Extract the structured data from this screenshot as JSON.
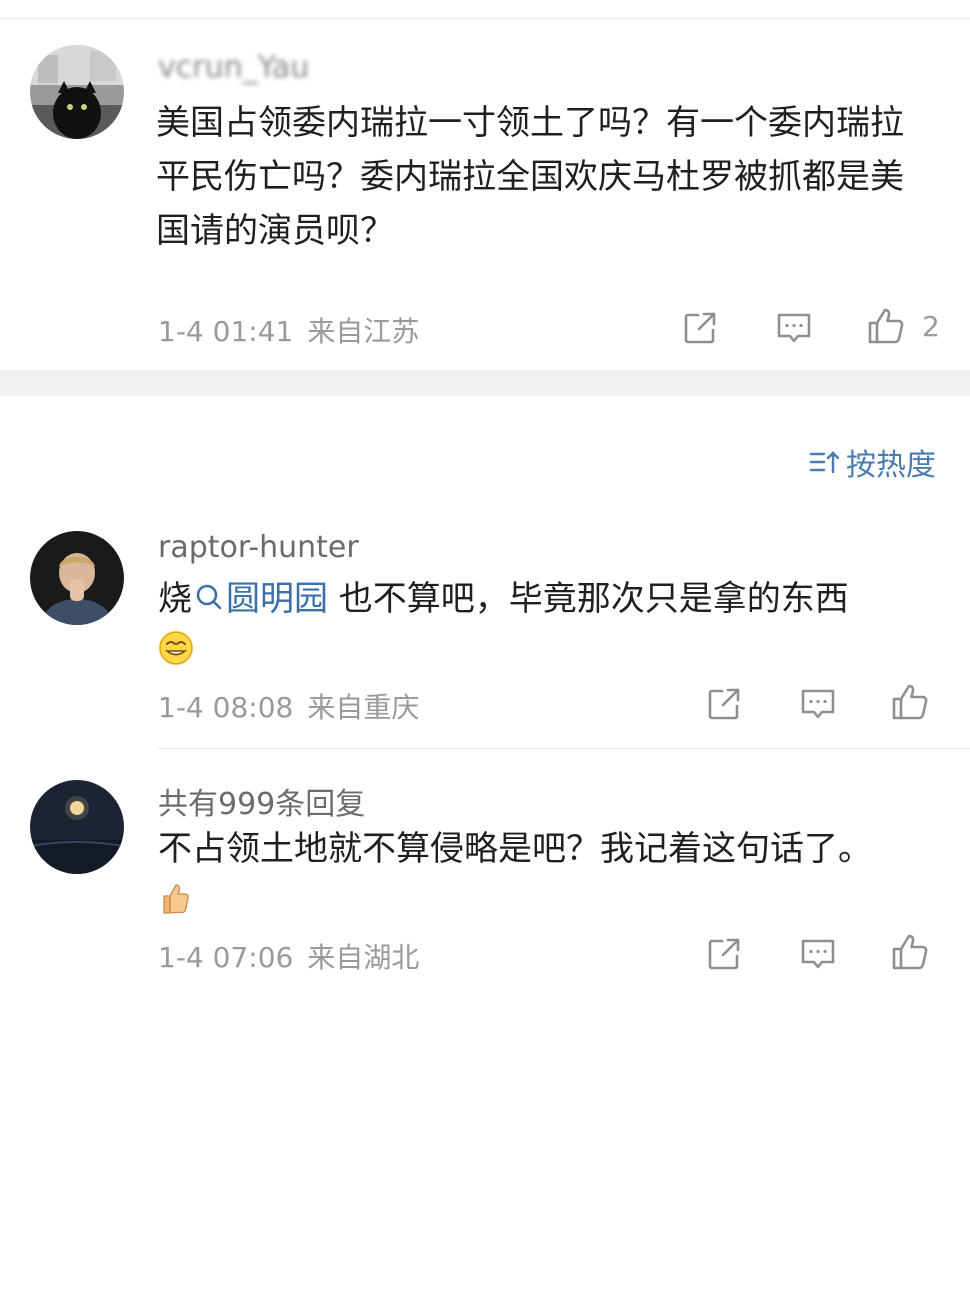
{
  "comments": [
    {
      "username": "vcrun_Yau",
      "text": "美国占领委内瑞拉一寸领土了吗？有一个委内瑞拉平民伤亡吗？委内瑞拉全国欢庆马杜罗被抓都是美国请的演员呗？",
      "time": "1-4 01:41",
      "location": "来自江苏",
      "likes": "2"
    },
    {
      "username": "raptor-hunter",
      "text_prefix": "烧",
      "topic": "圆明园",
      "text_suffix": " 也不算吧，毕竟那次只是拿的东西",
      "emoji_icon": "grin-face-emoji",
      "time": "1-4 08:08",
      "location": "来自重庆"
    },
    {
      "username": "共有999条回复",
      "text": "不占领土地就不算侵略是吧？我记着这句话了。",
      "emoji_icon": "thumbs-up-emoji",
      "time": "1-4 07:06",
      "location": "来自湖北"
    }
  ],
  "sort": {
    "label": "按热度",
    "icon": "sort-icon"
  },
  "colors": {
    "link": "#3a6fa8",
    "sort": "#4a7bb0",
    "meta": "#9a9a9a",
    "divider": "#f1f1f1"
  }
}
